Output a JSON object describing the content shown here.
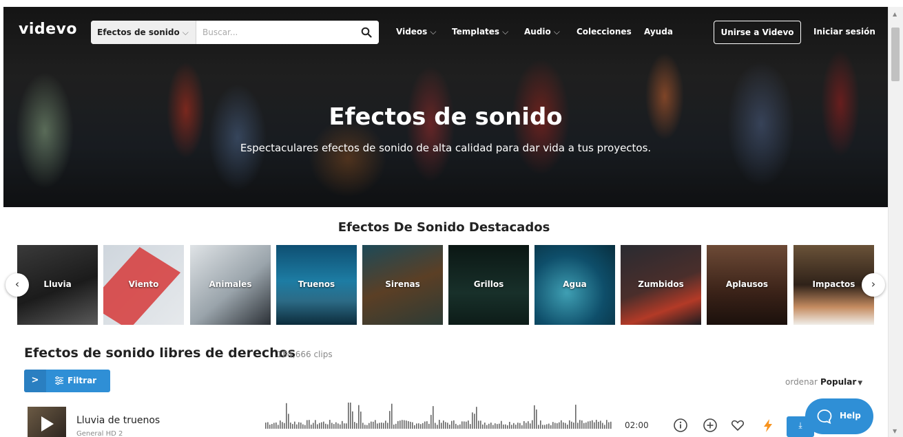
{
  "nav": {
    "logo": "videvo",
    "search_category": "Efectos de sonido",
    "search_placeholder": "Buscar...",
    "links": [
      "Videos",
      "Templates",
      "Audio",
      "Colecciones",
      "Ayuda"
    ],
    "join_label": "Unirse a Videvo",
    "login_label": "Iniciar sesión"
  },
  "hero": {
    "title": "Efectos de sonido",
    "subtitle": "Espectaculares efectos de sonido de alta calidad para dar vida a tus proyectos."
  },
  "featured": {
    "title": "Efectos De Sonido Destacados",
    "categories": [
      "Lluvia",
      "Viento",
      "Animales",
      "Truenos",
      "Sirenas",
      "Grillos",
      "Agua",
      "Zumbidos",
      "Aplausos",
      "Impactos"
    ]
  },
  "list": {
    "title": "Efectos de sonido libres de derechos",
    "count": "184,666 clips",
    "filter_label": "Filtrar",
    "sort_prefix": "ordenar",
    "sort_value": "Popular"
  },
  "clip": {
    "title": "Lluvia de truenos",
    "subtitle": "General HD 2",
    "duration": "02:00"
  },
  "help": {
    "label": "Help"
  },
  "colors": {
    "accent": "#2f8fd6",
    "premium": "#f7931e"
  }
}
